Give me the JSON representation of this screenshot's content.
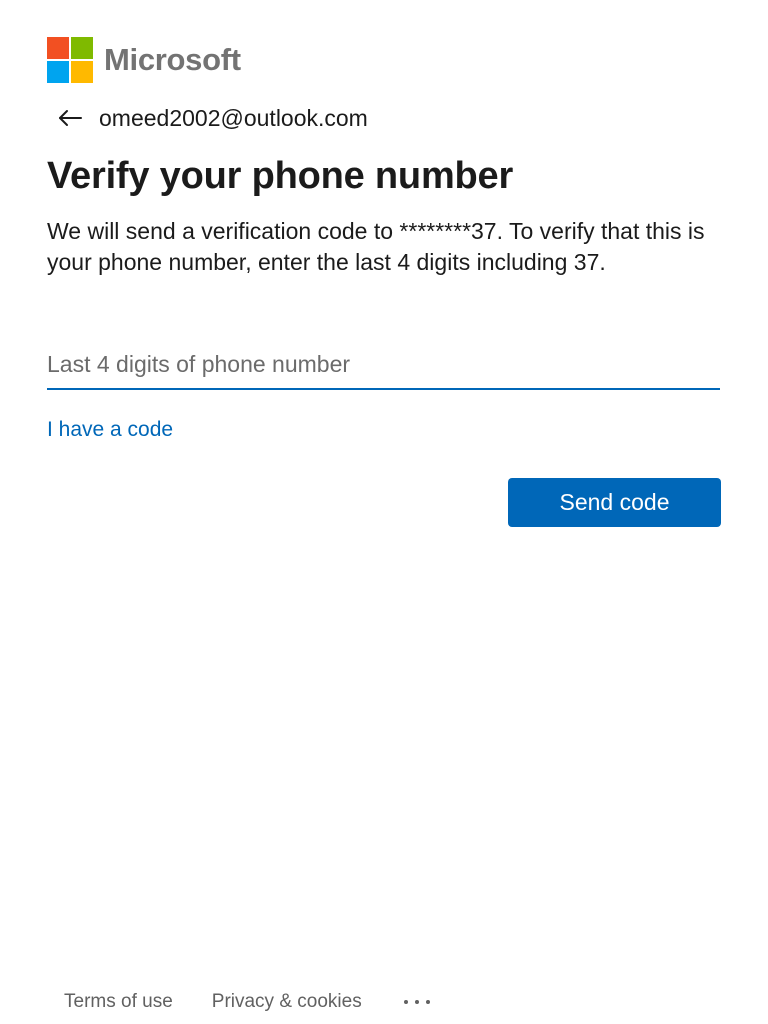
{
  "brand": {
    "name": "Microsoft",
    "logo_colors": [
      "#f25022",
      "#7fba00",
      "#00a4ef",
      "#ffb900"
    ]
  },
  "identity": {
    "email": "omeed2002@outlook.com",
    "back_icon": "back-arrow-icon"
  },
  "title": "Verify your phone number",
  "description": "We will send a verification code to ********37. To verify that this is your phone number, enter the last 4 digits including 37.",
  "phone_input": {
    "value": "",
    "placeholder": "Last 4 digits of phone number"
  },
  "have_code_link": "I have a code",
  "send_button": "Send code",
  "footer": {
    "terms": "Terms of use",
    "privacy": "Privacy & cookies",
    "more_icon": "more-options-icon"
  },
  "colors": {
    "accent": "#0067b8",
    "text": "#1b1b1b",
    "muted": "#616161"
  }
}
